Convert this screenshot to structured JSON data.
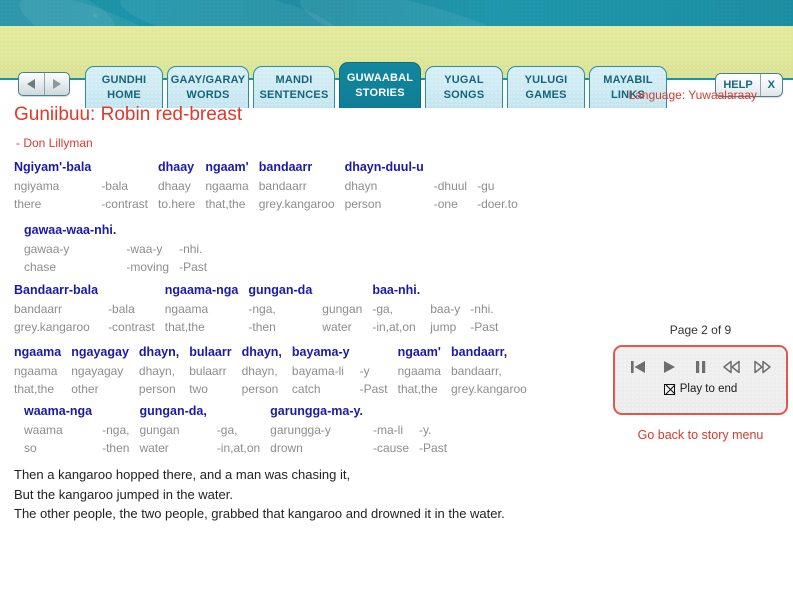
{
  "header": {
    "nav": {
      "prev_icon": "triangle-left-icon",
      "next_icon": "triangle-right-icon"
    },
    "tabs": [
      {
        "line1": "GUNDHI",
        "line2": "HOME",
        "active": false
      },
      {
        "line1": "GAAY/GARAY",
        "line2": "WORDS",
        "active": false
      },
      {
        "line1": "MANDI",
        "line2": "SENTENCES",
        "active": false
      },
      {
        "line1": "GUWAABAL",
        "line2": "STORIES",
        "active": true
      },
      {
        "line1": "YUGAL",
        "line2": "SONGS",
        "active": false
      },
      {
        "line1": "YULUGI",
        "line2": "GAMES",
        "active": false
      },
      {
        "line1": "MAYABIL",
        "line2": "LINKS",
        "active": false
      }
    ],
    "help_label": "HELP",
    "close_label": "X"
  },
  "page": {
    "language_label": "Language: Yuwaalaraay",
    "title": "Guniibuu: Robin red-breast",
    "author": "- Don Lillyman"
  },
  "glosses": [
    {
      "id": "gloss-1",
      "rows": [
        [
          "Ngiyam'-bala",
          "",
          "dhaay",
          "ngaam'",
          "bandaarr",
          "dhayn-duul-u",
          "",
          ""
        ],
        [
          "ngiyama",
          "-bala",
          "dhaay",
          "ngaama",
          "bandaarr",
          "dhayn",
          "-dhuul",
          "-gu"
        ],
        [
          "there",
          "-contrast",
          "to.here",
          "that,the",
          "grey.kangaroo",
          "person",
          "-one",
          "-doer.to"
        ]
      ]
    },
    {
      "id": "gloss-2",
      "rows": [
        [
          "gawaa-waa-nhi.",
          "",
          ""
        ],
        [
          "gawaa-y",
          "-waa-y",
          "-nhi."
        ],
        [
          "chase",
          "-moving",
          "-Past"
        ]
      ]
    },
    {
      "id": "gloss-3",
      "rows": [
        [
          "Bandaarr-bala",
          "",
          "ngaama-nga",
          "gungan-da",
          "",
          "baa-nhi.",
          ""
        ],
        [
          "bandaarr",
          "-bala",
          "ngaama",
          "-nga,",
          "gungan",
          "-ga,",
          "baa-y",
          "-nhi."
        ],
        [
          "grey.kangaroo",
          "-contrast",
          "that,the",
          "-then",
          "water",
          "-in,at,on",
          "jump",
          "-Past"
        ]
      ]
    },
    {
      "id": "gloss-4",
      "rows": [
        [
          "ngaama",
          "ngayagay",
          "dhayn,",
          "bulaarr",
          "dhayn,",
          "bayama-y",
          "",
          "ngaam'",
          "bandaarr,"
        ],
        [
          "ngaama",
          "ngayagay",
          "dhayn,",
          "bulaarr",
          "dhayn,",
          "bayama-li",
          "-y",
          "ngaama",
          "bandaarr,"
        ],
        [
          "that,the",
          "other",
          "person",
          "two",
          "person",
          "catch",
          "-Past",
          "that,the",
          "grey.kangaroo"
        ]
      ]
    },
    {
      "id": "gloss-5",
      "rows": [
        [
          "waama-nga",
          "",
          "gungan-da,",
          "",
          "garungga-ma-y.",
          "",
          ""
        ],
        [
          "waama",
          "-nga,",
          "gungan",
          "-ga,",
          "garungga-y",
          "-ma-li",
          "-y."
        ],
        [
          "so",
          "-then",
          "water",
          "-in,at,on",
          "drown",
          "-cause",
          "-Past"
        ]
      ]
    }
  ],
  "free_translation": [
    "Then a kangaroo hopped there, and a man was chasing it,",
    "But the kangaroo jumped in the water.",
    "The other people, the two people, grabbed that kangaroo and drowned it in the water."
  ],
  "player": {
    "page_indicator": "Page 2 of 9",
    "buttons": [
      {
        "name": "skip-to-start-icon",
        "label": "Skip to start"
      },
      {
        "name": "play-icon",
        "label": "Play"
      },
      {
        "name": "pause-icon",
        "label": "Pause"
      },
      {
        "name": "previous-icon",
        "label": "Previous"
      },
      {
        "name": "next-icon",
        "label": "Next"
      }
    ],
    "play_to_end_label": "Play to end",
    "play_to_end_checked": true,
    "back_link": "Go back to story menu"
  },
  "colors": {
    "banner_teal": "#1b93a8",
    "tabbar_khaki": "#dfe79a",
    "tab_light": "#cdeaf3",
    "tab_active": "#0e7e95",
    "accent_red": "#e0392c",
    "gloss_blue": "#1a1aa8",
    "gloss_grey": "#8d8d8d",
    "player_border": "#e8554a"
  }
}
